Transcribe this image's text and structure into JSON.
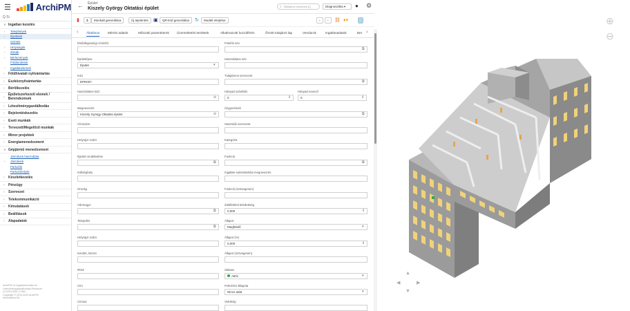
{
  "app": {
    "logo_text": "ArchiPM",
    "logo_colors": [
      "#e94b3c",
      "#f39c12",
      "#f7c600",
      "#2e86c1"
    ]
  },
  "sidebar": {
    "search_placeholder": "Q Si",
    "items": [
      {
        "label": "Ingatlan kezelés",
        "type": "group",
        "open": true
      },
      {
        "label": "Telephelyek",
        "type": "sub",
        "chev": true
      },
      {
        "label": "Épületek",
        "type": "sub",
        "chev": true,
        "active": true
      },
      {
        "label": "Szintek",
        "type": "sub"
      },
      {
        "label": "Helyiségek",
        "type": "sub",
        "chev": true
      },
      {
        "label": "Zónák",
        "type": "sub",
        "chev": true
      },
      {
        "label": "Bérlemények",
        "type": "sub",
        "chev": true
      },
      {
        "label": "Földterületek",
        "type": "sub"
      },
      {
        "label": "Ingatlanelemek",
        "type": "sub",
        "chev": true
      },
      {
        "label": "Földhivatali nyilvántartás",
        "type": "group"
      },
      {
        "label": "Eszköznyilvántartás",
        "type": "group"
      },
      {
        "label": "Bérlőkezelés",
        "type": "group"
      },
      {
        "label": "Épületszerkezeti elemek / Berendezések",
        "type": "group",
        "tall": true
      },
      {
        "label": "Létesítménygazdálkodás",
        "type": "group"
      },
      {
        "label": "Bejelentéskezelés",
        "type": "group"
      },
      {
        "label": "Eseti munkák",
        "type": "group"
      },
      {
        "label": "Tervezett/Megelőző munkák",
        "type": "group"
      },
      {
        "label": "Minor projektek",
        "type": "group"
      },
      {
        "label": "Energiamenedzsment",
        "type": "group"
      },
      {
        "label": "Gépjármű menedzsment",
        "type": "group",
        "open": true
      },
      {
        "label": "Járművek használata",
        "type": "sub"
      },
      {
        "label": "Járművek",
        "type": "sub",
        "chev": true
      },
      {
        "label": "Parkolók",
        "type": "sub"
      },
      {
        "label": "Parkolóhelyek",
        "type": "sub"
      },
      {
        "label": "Készletkezelés",
        "type": "group"
      },
      {
        "label": "Pénzügy",
        "type": "group"
      },
      {
        "label": "Szervezet",
        "type": "group"
      },
      {
        "label": "Telekommunikáció",
        "type": "group"
      },
      {
        "label": "Kimutatások",
        "type": "group"
      },
      {
        "label": "Beállítások",
        "type": "group"
      },
      {
        "label": "Alapadatok",
        "type": "group"
      }
    ],
    "footer": [
      "ArchiPM v3 Ingatlankezelési és",
      "Létesítménygazdálkodási Rendszer",
      "v3.2023.0001.17664",
      "Copyright © 2010-2023 ArchiPM",
      "Informatikai Kft."
    ]
  },
  "header": {
    "breadcrumb": "Épület",
    "title": "Kiszely György Oktatási épület",
    "search_placeholder": "Általános üzenetek (I)",
    "view_select": "Diagnosztika"
  },
  "toolbar": {
    "buttons": [
      "Munkalt generálása",
      "Új tejelentés",
      "QR-kód generálása",
      "Modell elrejtése"
    ]
  },
  "tabs": {
    "items": [
      "Általános",
      "Mérési adatok",
      "Műszaki paraméterek",
      "Üzemeltetési területek",
      "Alkalmazotti hozzáférés",
      "Őrzött tulajdoni lap",
      "Vendorok",
      "Ingatlanadatok",
      "Ber"
    ]
  },
  "form": {
    "fields": [
      {
        "label": "Elsődlegességi címinfol",
        "value": "",
        "col": 0,
        "row": 0
      },
      {
        "label": "Felelős név",
        "value": "",
        "col": 1,
        "row": 0,
        "btn": "⧉"
      },
      {
        "label": "Épülettípus",
        "value": "Épület",
        "col": 0,
        "row": 1,
        "btn": "▾"
      },
      {
        "label": "Használatos név",
        "value": "",
        "col": 1,
        "row": 1
      },
      {
        "label": "Kód",
        "value": "EPD007",
        "col": 0,
        "row": 2
      },
      {
        "label": "Tulajdonos szervezet",
        "value": "",
        "col": 1,
        "row": 2,
        "btn": "⧉"
      },
      {
        "label": "Használatos kód",
        "value": "",
        "col": 0,
        "row": 3,
        "btn": "⊘"
      },
      {
        "label": "Hányad számláló",
        "value": "0",
        "col": 1,
        "row": 3,
        "half": true,
        "btn": "⇕"
      },
      {
        "label": "Hányad nevező",
        "value": "0",
        "col": 2,
        "row": 3,
        "half": true,
        "btn": "⇕"
      },
      {
        "label": "Megnevezés",
        "value": "Kiszely György Oktatási épület",
        "col": 0,
        "row": 4,
        "btn": "⊘"
      },
      {
        "label": "Üzgyeréseló",
        "value": "",
        "col": 1,
        "row": 4,
        "btn": "⧉"
      },
      {
        "label": "Címszám",
        "value": "",
        "col": 0,
        "row": 5
      },
      {
        "label": "Használó szervezet",
        "value": "",
        "col": 1,
        "row": 5
      },
      {
        "label": "Helyrajzi szám",
        "value": "",
        "col": 0,
        "row": 6
      },
      {
        "label": "Kategória",
        "value": "",
        "col": 1,
        "row": 6
      },
      {
        "label": "Épület rendeltetése",
        "value": "",
        "col": 0,
        "row": 7,
        "btn": "⧉"
      },
      {
        "label": "Funkció",
        "value": "",
        "col": 1,
        "row": 7,
        "btn": "⧉"
      },
      {
        "label": "Költséghely",
        "value": "",
        "col": 0,
        "row": 8
      },
      {
        "label": "Ingatlan-nyilvántartási megnevezés",
        "value": "",
        "col": 1,
        "row": 8
      },
      {
        "label": "Ország",
        "value": "",
        "col": 0,
        "row": 9
      },
      {
        "label": "Funkció (szövegesen)",
        "value": "",
        "col": 1,
        "row": 9
      },
      {
        "label": "Vármegye",
        "value": "",
        "col": 0,
        "row": 10,
        "btn": "⧉"
      },
      {
        "label": "Zöldfelületi lefedettség",
        "value": "0,000",
        "col": 1,
        "row": 10,
        "btn": "⇕"
      },
      {
        "label": "Település",
        "value": "",
        "col": 0,
        "row": 11,
        "btn": "⧉"
      },
      {
        "label": "Állapot",
        "value": "Megfelelő",
        "col": 1,
        "row": 11,
        "btn": "▾"
      },
      {
        "label": "Helyrajzi szám",
        "value": "",
        "col": 0,
        "row": 12
      },
      {
        "label": "Állapot (%)",
        "value": "0,000",
        "col": 1,
        "row": 12,
        "btn": "⇕"
      },
      {
        "label": "Kerület, körzet",
        "value": "",
        "col": 0,
        "row": 13
      },
      {
        "label": "Állapot (szövegesen)",
        "value": "",
        "col": 1,
        "row": 13
      },
      {
        "label": "IRSZ",
        "value": "",
        "col": 0,
        "row": 14
      },
      {
        "label": "Státusz",
        "value": "Aktív",
        "col": 1,
        "row": 14,
        "btn": "▾",
        "dot": "#2eaa4f"
      },
      {
        "label": "Cím",
        "value": "",
        "col": 0,
        "row": 15
      },
      {
        "label": "Felmérés állapota",
        "value": "Nincs adat",
        "col": 1,
        "row": 15,
        "btn": "▾"
      },
      {
        "label": "Címsor",
        "value": "",
        "col": 0,
        "row": 16
      },
      {
        "label": "Vetülség",
        "value": "",
        "col": 1,
        "row": 16
      }
    ]
  },
  "viewer": {
    "colors": {
      "wall": "#9a9a9a",
      "side": "#808080",
      "window": "#f1d27a",
      "accent": "#f39c12"
    }
  }
}
